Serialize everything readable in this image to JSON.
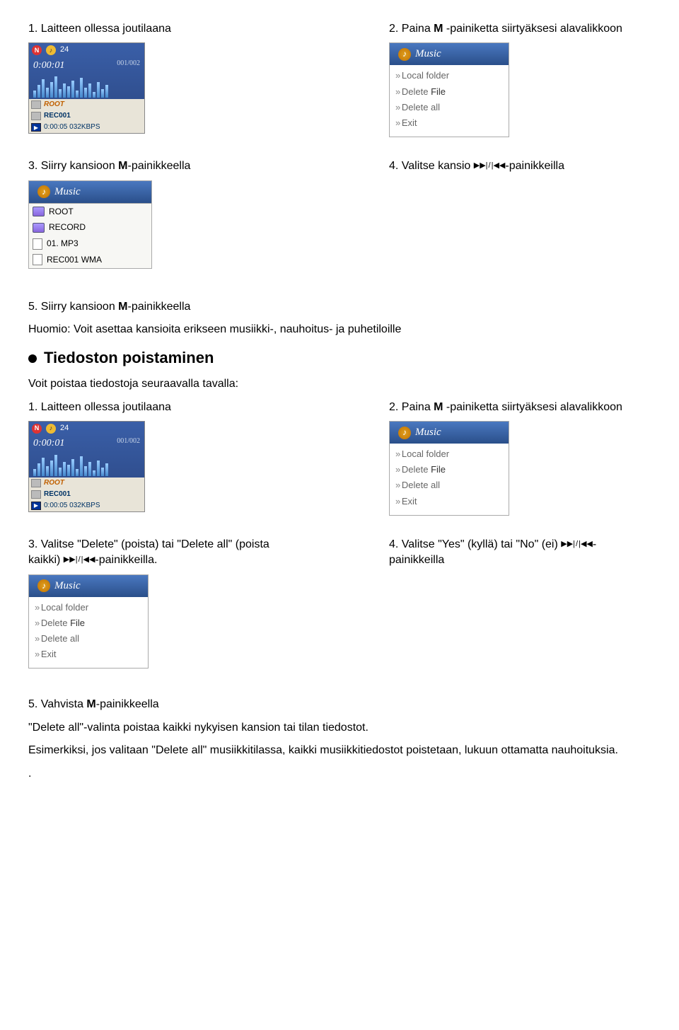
{
  "step1": "1. Laitteen ollessa joutilaana",
  "step2_prefix": "2. Paina ",
  "step2_bold": "M",
  "step2_suffix": " -painiketta siirtyäksesi alavalikkoon",
  "step3_prefix": "3. Siirry kansioon ",
  "step3_bold": "M",
  "step3_suffix": "-painikkeella",
  "step4_prefix": "4. Valitse kansio ",
  "step4_suffix": "-painikkeilla",
  "step5_prefix": "5. Siirry kansioon ",
  "step5_bold": "M",
  "step5_suffix": "-painikkeella",
  "huomio": "Huomio: Voit asettaa kansioita erikseen musiikki-, nauhoitus- ja puhetiloille",
  "heading_tiedoston": "Tiedoston poistaminen",
  "para_voit": "Voit poistaa tiedostoja seuraavalla tavalla:",
  "step1b": "1. Laitteen ollessa joutilaana",
  "step2b_prefix": "2. Paina ",
  "step2b_bold": "M",
  "step2b_suffix": " -painiketta siirtyäksesi alavalikkoon",
  "step3b_line1": "3. Valitse \"Delete\" (poista) tai \"Delete all\" (poista",
  "step3b_line2_prefix": "kaikki) ",
  "step3b_line2_suffix": "-painikkeilla.",
  "step4b_line1_prefix": "4. Valitse \"Yes\" (kyllä) tai \"No\" (ei) ",
  "step4b_line1_suffix": "-",
  "step4b_line2": "painikkeilla",
  "step5b_prefix": "5. Vahvista ",
  "step5b_bold": "M",
  "step5b_suffix": "-painikkeella",
  "para_delete_all": "\"Delete all\"-valinta poistaa kaikki nykyisen kansion tai tilan tiedostot.",
  "para_esim": "Esimerkiksi, jos valitaan \"Delete all\" musiikkitilassa, kaikki musiikkitiedostot poistetaan, lukuun ottamatta nauhoituksia.",
  "dot": ".",
  "player": {
    "top_n": "N",
    "top_y": "♪",
    "top_num": "24",
    "time": "0:00:01",
    "frac": "001/002",
    "root": "ROOT",
    "rec": "REC001",
    "footer": "0:00:05 032KBPS"
  },
  "music": {
    "title": "Music",
    "items": [
      "Local folder",
      "Delete",
      "Delete all",
      "Exit"
    ],
    "file_word": "File"
  },
  "folders": {
    "title": "Music",
    "root": "ROOT",
    "record": "RECORD",
    "mp3": "01. MP3",
    "wma": "REC001  WMA"
  },
  "skip_fwd": "▶▶|",
  "skip_back": "|◀◀",
  "slash": "/"
}
